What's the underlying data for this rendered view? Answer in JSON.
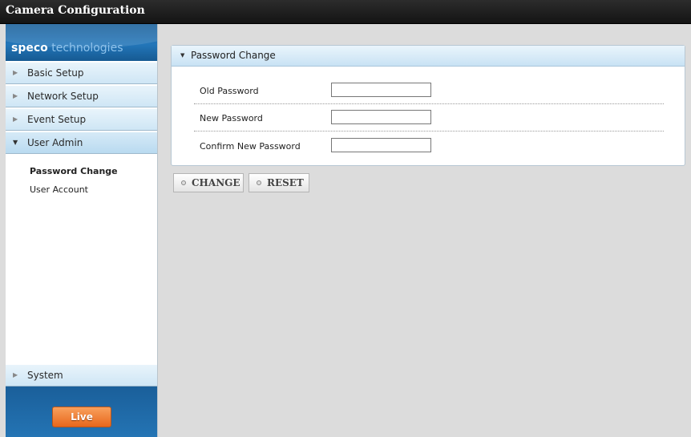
{
  "window": {
    "title": "Camera Configuration"
  },
  "logo": {
    "brand_bold": "speco",
    "brand_light": " technologies"
  },
  "sidebar": {
    "menu": [
      {
        "label": "Basic Setup",
        "expanded": false
      },
      {
        "label": "Network Setup",
        "expanded": false
      },
      {
        "label": "Event Setup",
        "expanded": false
      },
      {
        "label": "User Admin",
        "expanded": true
      }
    ],
    "submenu": [
      {
        "label": "Password Change",
        "active": true
      },
      {
        "label": "User Account",
        "active": false
      }
    ],
    "system": {
      "label": "System"
    },
    "live_label": "Live"
  },
  "panel": {
    "title": "Password Change",
    "fields": [
      {
        "label": "Old Password",
        "value": ""
      },
      {
        "label": "New Password",
        "value": ""
      },
      {
        "label": "Confirm New Password",
        "value": ""
      }
    ]
  },
  "actions": {
    "change_label": "CHANGE",
    "reset_label": "RESET"
  },
  "colors": {
    "accent_blue": "#2376b9",
    "live_orange": "#e8671c"
  }
}
